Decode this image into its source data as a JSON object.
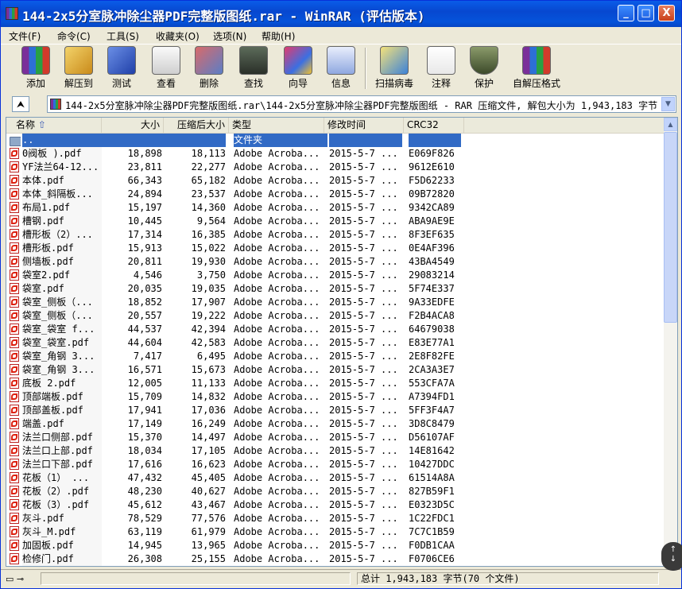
{
  "window": {
    "title": "144-2x5分室脉冲除尘器PDF完整版图纸.rar - WinRAR (评估版本)",
    "controls": [
      "_",
      "□",
      "X"
    ]
  },
  "menu": [
    {
      "label": "文件(F)"
    },
    {
      "label": "命令(C)"
    },
    {
      "label": "工具(S)"
    },
    {
      "label": "收藏夹(O)"
    },
    {
      "label": "选项(N)"
    },
    {
      "label": "帮助(H)"
    }
  ],
  "toolbar": [
    {
      "label": "添加",
      "icon": "add-books-icon"
    },
    {
      "label": "解压到",
      "icon": "extract-to-icon"
    },
    {
      "label": "测试",
      "icon": "test-icon"
    },
    {
      "label": "查看",
      "icon": "view-glasses-icon"
    },
    {
      "label": "删除",
      "icon": "delete-icon"
    },
    {
      "label": "查找",
      "icon": "find-binoculars-icon"
    },
    {
      "label": "向导",
      "icon": "wizard-icon"
    },
    {
      "label": "信息",
      "icon": "info-icon"
    },
    {
      "label": "扫描病毒",
      "icon": "virus-scan-icon"
    },
    {
      "label": "注释",
      "icon": "comment-icon"
    },
    {
      "label": "保护",
      "icon": "protect-shield-icon"
    },
    {
      "label": "自解压格式",
      "icon": "sfx-icon"
    }
  ],
  "address": {
    "path": "144-2x5分室脉冲除尘器PDF完整版图纸.rar\\144-2x5分室脉冲除尘器PDF完整版图纸 - RAR 压缩文件, 解包大小为 1,943,183 字节"
  },
  "columns": {
    "name": "名称",
    "size": "大小",
    "packed": "压缩后大小",
    "type": "类型",
    "modified": "修改时间",
    "crc": "CRC32"
  },
  "parent_row": {
    "name": "..",
    "type": "文件夹"
  },
  "files": [
    {
      "name": "0阀板 ).pdf",
      "size": "18,898",
      "packed": "18,113",
      "type": "Adobe Acroba...",
      "modified": "2015-5-7 ...",
      "crc": "E069F826"
    },
    {
      "name": "YF法兰64-12...",
      "size": "23,811",
      "packed": "22,277",
      "type": "Adobe Acroba...",
      "modified": "2015-5-7 ...",
      "crc": "9612E610"
    },
    {
      "name": "本体.pdf",
      "size": "66,343",
      "packed": "65,182",
      "type": "Adobe Acroba...",
      "modified": "2015-5-7 ...",
      "crc": "F5D62233"
    },
    {
      "name": "本体_斜隔板...",
      "size": "24,894",
      "packed": "23,537",
      "type": "Adobe Acroba...",
      "modified": "2015-5-7 ...",
      "crc": "09B72820"
    },
    {
      "name": "布局1.pdf",
      "size": "15,197",
      "packed": "14,360",
      "type": "Adobe Acroba...",
      "modified": "2015-5-7 ...",
      "crc": "9342CA89"
    },
    {
      "name": "槽钢.pdf",
      "size": "10,445",
      "packed": "9,564",
      "type": "Adobe Acroba...",
      "modified": "2015-5-7 ...",
      "crc": "ABA9AE9E"
    },
    {
      "name": "槽形板（2）...",
      "size": "17,314",
      "packed": "16,385",
      "type": "Adobe Acroba...",
      "modified": "2015-5-7 ...",
      "crc": "8F3EF635"
    },
    {
      "name": "槽形板.pdf",
      "size": "15,913",
      "packed": "15,022",
      "type": "Adobe Acroba...",
      "modified": "2015-5-7 ...",
      "crc": "0E4AF396"
    },
    {
      "name": "侧墙板.pdf",
      "size": "20,811",
      "packed": "19,930",
      "type": "Adobe Acroba...",
      "modified": "2015-5-7 ...",
      "crc": "43BA4549"
    },
    {
      "name": "袋室2.pdf",
      "size": "4,546",
      "packed": "3,750",
      "type": "Adobe Acroba...",
      "modified": "2015-5-7 ...",
      "crc": "29083214"
    },
    {
      "name": "袋室.pdf",
      "size": "20,035",
      "packed": "19,035",
      "type": "Adobe Acroba...",
      "modified": "2015-5-7 ...",
      "crc": "5F74E337"
    },
    {
      "name": "袋室_侧板（...",
      "size": "18,852",
      "packed": "17,907",
      "type": "Adobe Acroba...",
      "modified": "2015-5-7 ...",
      "crc": "9A33EDFE"
    },
    {
      "name": "袋室_侧板（...",
      "size": "20,557",
      "packed": "19,222",
      "type": "Adobe Acroba...",
      "modified": "2015-5-7 ...",
      "crc": "F2B4ACA8"
    },
    {
      "name": "袋室_袋室 f...",
      "size": "44,537",
      "packed": "42,394",
      "type": "Adobe Acroba...",
      "modified": "2015-5-7 ...",
      "crc": "64679038"
    },
    {
      "name": "袋室_袋室.pdf",
      "size": "44,604",
      "packed": "42,583",
      "type": "Adobe Acroba...",
      "modified": "2015-5-7 ...",
      "crc": "E83E77A1"
    },
    {
      "name": "袋室_角钢 3...",
      "size": "7,417",
      "packed": "6,495",
      "type": "Adobe Acroba...",
      "modified": "2015-5-7 ...",
      "crc": "2E8F82FE"
    },
    {
      "name": "袋室_角钢 3...",
      "size": "16,571",
      "packed": "15,673",
      "type": "Adobe Acroba...",
      "modified": "2015-5-7 ...",
      "crc": "2CA3A3E7"
    },
    {
      "name": "底板 2.pdf",
      "size": "12,005",
      "packed": "11,133",
      "type": "Adobe Acroba...",
      "modified": "2015-5-7 ...",
      "crc": "553CFA7A"
    },
    {
      "name": "顶部端板.pdf",
      "size": "15,709",
      "packed": "14,832",
      "type": "Adobe Acroba...",
      "modified": "2015-5-7 ...",
      "crc": "A7394FD1"
    },
    {
      "name": "顶部盖板.pdf",
      "size": "17,941",
      "packed": "17,036",
      "type": "Adobe Acroba...",
      "modified": "2015-5-7 ...",
      "crc": "5FF3F4A7"
    },
    {
      "name": "端盖.pdf",
      "size": "17,149",
      "packed": "16,249",
      "type": "Adobe Acroba...",
      "modified": "2015-5-7 ...",
      "crc": "3D8C8479"
    },
    {
      "name": "法兰口侧部.pdf",
      "size": "15,370",
      "packed": "14,497",
      "type": "Adobe Acroba...",
      "modified": "2015-5-7 ...",
      "crc": "D56107AF"
    },
    {
      "name": "法兰口上部.pdf",
      "size": "18,034",
      "packed": "17,105",
      "type": "Adobe Acroba...",
      "modified": "2015-5-7 ...",
      "crc": "14E81642"
    },
    {
      "name": "法兰口下部.pdf",
      "size": "17,616",
      "packed": "16,623",
      "type": "Adobe Acroba...",
      "modified": "2015-5-7 ...",
      "crc": "10427DDC"
    },
    {
      "name": "花板（1）  ...",
      "size": "47,432",
      "packed": "45,405",
      "type": "Adobe Acroba...",
      "modified": "2015-5-7 ...",
      "crc": "61514A8A"
    },
    {
      "name": "花板（2）.pdf",
      "size": "48,230",
      "packed": "40,627",
      "type": "Adobe Acroba...",
      "modified": "2015-5-7 ...",
      "crc": "827B59F1"
    },
    {
      "name": "花板（3）.pdf",
      "size": "45,612",
      "packed": "43,467",
      "type": "Adobe Acroba...",
      "modified": "2015-5-7 ...",
      "crc": "E0323D5C"
    },
    {
      "name": "灰斗.pdf",
      "size": "78,529",
      "packed": "77,576",
      "type": "Adobe Acroba...",
      "modified": "2015-5-7 ...",
      "crc": "1C22FDC1"
    },
    {
      "name": "灰斗_M.pdf",
      "size": "63,119",
      "packed": "61,979",
      "type": "Adobe Acroba...",
      "modified": "2015-5-7 ...",
      "crc": "7C7C1B59"
    },
    {
      "name": "加固板.pdf",
      "size": "14,945",
      "packed": "13,965",
      "type": "Adobe Acroba...",
      "modified": "2015-5-7 ...",
      "crc": "F0DB1CAA"
    },
    {
      "name": "检修门.pdf",
      "size": "26,308",
      "packed": "25,155",
      "type": "Adobe Acroba...",
      "modified": "2015-5-7 ...",
      "crc": "F0706CE6"
    }
  ],
  "status": {
    "total": "总计 1,943,183 字节(70 个文件)"
  }
}
